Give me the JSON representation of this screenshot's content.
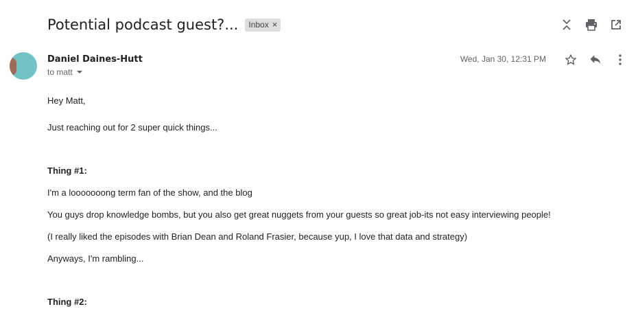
{
  "email": {
    "subject": "Potential podcast guest?...",
    "label": "Inbox",
    "label_remove": "×",
    "sender": "Daniel Daines-Hutt",
    "to": "to matt",
    "date": "Wed, Jan 30, 12:31 PM"
  },
  "toolbar": {
    "icons": [
      "expand-collapse-icon",
      "print-icon",
      "open-in-new-window-icon"
    ]
  },
  "message_actions": {
    "icons": [
      "star-icon",
      "reply-icon",
      "more-options-icon"
    ]
  },
  "body": {
    "greeting": "Hey Matt,",
    "intro": "Just reaching out for 2 super quick things...",
    "thing1_heading": "Thing #1:",
    "p1": "I'm a looooooong term fan of the show, and the blog",
    "p2": "You guys drop knowledge bombs, but you also get great nuggets from your guests so great job-its not easy interviewing people!",
    "p3": "(I really liked the episodes with Brian Dean and Roland Frasier, because yup, I love that data and strategy)",
    "p4": "Anyways, I'm rambling...",
    "thing2_heading": "Thing #2:"
  },
  "colors": {
    "avatar_bg": "#72c1c4",
    "label_bg": "#dddddd",
    "icon": "#5f6368"
  }
}
